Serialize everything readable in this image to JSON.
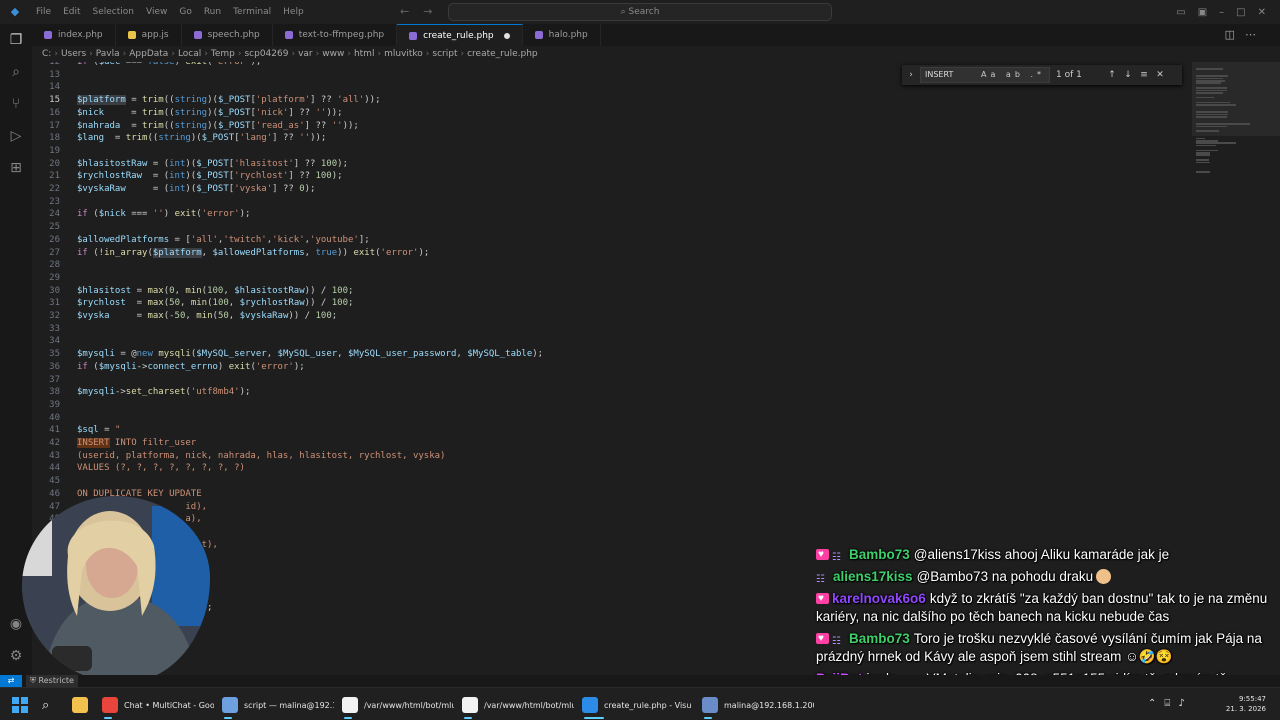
{
  "menu": [
    "File",
    "Edit",
    "Selection",
    "View",
    "Go",
    "Run",
    "Terminal",
    "Help"
  ],
  "search_placeholder": "Search",
  "tabs": [
    {
      "label": "index.php",
      "color": "#8c6bd6"
    },
    {
      "label": "app.js",
      "color": "#e8c44a"
    },
    {
      "label": "speech.php",
      "color": "#8c6bd6"
    },
    {
      "label": "text-to-ffmpeg.php",
      "color": "#8c6bd6"
    },
    {
      "label": "create_rule.php",
      "color": "#8c6bd6",
      "active": true,
      "modified": true
    },
    {
      "label": "halo.php",
      "color": "#8c6bd6"
    }
  ],
  "breadcrumb": [
    "C:",
    "Users",
    "Pavla",
    "AppData",
    "Local",
    "Temp",
    "scp04269",
    "var",
    "www",
    "html",
    "mluvitko",
    "script",
    "create_rule.php"
  ],
  "find": {
    "query": "INSERT",
    "result": "1 of 1",
    "options": "Aa ab .*"
  },
  "code": [
    {
      "n": "12",
      "html": "<span class=\"tok-ctl\">if</span> (<span class=\"tok-var\">$dec</span> === <span class=\"tok-kw\">false</span>) <span class=\"tok-fn\">exit</span>(<span class=\"tok-str\">'error'</span>);"
    },
    {
      "n": "13",
      "html": ""
    },
    {
      "n": "14",
      "html": ""
    },
    {
      "n": "15",
      "cur": true,
      "html": "<span class=\"tok-var sel\">$platform</span> = <span class=\"tok-fn\">trim</span>((<span class=\"tok-kw\">string</span>)(<span class=\"tok-var\">$_POST</span>[<span class=\"tok-str\">'platform'</span>] ?? <span class=\"tok-str\">'all'</span>));"
    },
    {
      "n": "16",
      "html": "<span class=\"tok-var\">$nick</span>     = <span class=\"tok-fn\">trim</span>((<span class=\"tok-kw\">string</span>)(<span class=\"tok-var\">$_POST</span>[<span class=\"tok-str\">'nick'</span>] ?? <span class=\"tok-str\">''</span>));"
    },
    {
      "n": "17",
      "html": "<span class=\"tok-var\">$nahrada</span>  = <span class=\"tok-fn\">trim</span>((<span class=\"tok-kw\">string</span>)(<span class=\"tok-var\">$_POST</span>[<span class=\"tok-str\">'read_as'</span>] ?? <span class=\"tok-str\">''</span>));"
    },
    {
      "n": "18",
      "html": "<span class=\"tok-var\">$lang</span>  = <span class=\"tok-fn\">trim</span>((<span class=\"tok-kw\">string</span>)(<span class=\"tok-var\">$_POST</span>[<span class=\"tok-str\">'lang'</span>] ?? <span class=\"tok-str\">''</span>));"
    },
    {
      "n": "19",
      "html": ""
    },
    {
      "n": "20",
      "html": "<span class=\"tok-var\">$hlasitostRaw</span> = (<span class=\"tok-kw\">int</span>)(<span class=\"tok-var\">$_POST</span>[<span class=\"tok-str\">'hlasitost'</span>] ?? <span class=\"tok-num\">100</span>);"
    },
    {
      "n": "21",
      "html": "<span class=\"tok-var\">$rychlostRaw</span>  = (<span class=\"tok-kw\">int</span>)(<span class=\"tok-var\">$_POST</span>[<span class=\"tok-str\">'rychlost'</span>] ?? <span class=\"tok-num\">100</span>);"
    },
    {
      "n": "22",
      "html": "<span class=\"tok-var\">$vyskaRaw</span>     = (<span class=\"tok-kw\">int</span>)(<span class=\"tok-var\">$_POST</span>[<span class=\"tok-str\">'vyska'</span>] ?? <span class=\"tok-num\">0</span>);"
    },
    {
      "n": "23",
      "html": ""
    },
    {
      "n": "24",
      "html": "<span class=\"tok-ctl\">if</span> (<span class=\"tok-var\">$nick</span> === <span class=\"tok-str\">''</span>) <span class=\"tok-fn\">exit</span>(<span class=\"tok-str\">'error'</span>);"
    },
    {
      "n": "25",
      "html": ""
    },
    {
      "n": "26",
      "html": "<span class=\"tok-var\">$allowedPlatforms</span> = [<span class=\"tok-str\">'all'</span>,<span class=\"tok-str\">'twitch'</span>,<span class=\"tok-str\">'kick'</span>,<span class=\"tok-str\">'youtube'</span>];"
    },
    {
      "n": "27",
      "html": "<span class=\"tok-ctl\">if</span> (!<span class=\"tok-fn\">in_array</span>(<span class=\"tok-var sel\">$platform</span>, <span class=\"tok-var\">$allowedPlatforms</span>, <span class=\"tok-kw\">true</span>)) <span class=\"tok-fn\">exit</span>(<span class=\"tok-str\">'error'</span>);"
    },
    {
      "n": "28",
      "html": ""
    },
    {
      "n": "29",
      "html": ""
    },
    {
      "n": "30",
      "html": "<span class=\"tok-var\">$hlasitost</span> = <span class=\"tok-fn\">max</span>(<span class=\"tok-num\">0</span>, <span class=\"tok-fn\">min</span>(<span class=\"tok-num\">100</span>, <span class=\"tok-var\">$hlasitostRaw</span>)) / <span class=\"tok-num\">100</span>;"
    },
    {
      "n": "31",
      "html": "<span class=\"tok-var\">$rychlost</span>  = <span class=\"tok-fn\">max</span>(<span class=\"tok-num\">50</span>, <span class=\"tok-fn\">min</span>(<span class=\"tok-num\">100</span>, <span class=\"tok-var\">$rychlostRaw</span>)) / <span class=\"tok-num\">100</span>;"
    },
    {
      "n": "32",
      "html": "<span class=\"tok-var\">$vyska</span>     = <span class=\"tok-fn\">max</span>(<span class=\"tok-num\">-50</span>, <span class=\"tok-fn\">min</span>(<span class=\"tok-num\">50</span>, <span class=\"tok-var\">$vyskaRaw</span>)) / <span class=\"tok-num\">100</span>;"
    },
    {
      "n": "33",
      "html": ""
    },
    {
      "n": "34",
      "html": ""
    },
    {
      "n": "35",
      "html": "<span class=\"tok-var\">$mysqli</span> = @<span class=\"tok-kw\">new</span> <span class=\"tok-fn\">mysqli</span>(<span class=\"tok-var\">$MySQL_server</span>, <span class=\"tok-var\">$MySQL_user</span>, <span class=\"tok-var\">$MySQL_user_password</span>, <span class=\"tok-var\">$MySQL_table</span>);"
    },
    {
      "n": "36",
      "html": "<span class=\"tok-ctl\">if</span> (<span class=\"tok-var\">$mysqli</span>-><span class=\"tok-var\">connect_errno</span>) <span class=\"tok-fn\">exit</span>(<span class=\"tok-str\">'error'</span>);"
    },
    {
      "n": "37",
      "html": ""
    },
    {
      "n": "38",
      "html": "<span class=\"tok-var\">$mysqli</span>-><span class=\"tok-fn\">set_charset</span>(<span class=\"tok-str\">'utf8mb4'</span>);"
    },
    {
      "n": "39",
      "html": ""
    },
    {
      "n": "40",
      "html": ""
    },
    {
      "n": "41",
      "html": "<span class=\"tok-var\">$sql</span> = <span class=\"tok-str\">\"</span>"
    },
    {
      "n": "42",
      "html": "<span class=\"tok-sql hl\">INSERT</span><span class=\"tok-sql\"> INTO filtr_user</span>"
    },
    {
      "n": "43",
      "html": "<span class=\"tok-sql\">(userid, platforma, nick, nahrada, hlas, hlasitost, rychlost, vyska)</span>"
    },
    {
      "n": "44",
      "html": "<span class=\"tok-sql\">VALUES (?, ?, ?, ?, ?, ?, ?, ?)</span>"
    },
    {
      "n": "45",
      "html": ""
    },
    {
      "n": "46",
      "html": "<span class=\"tok-sql\">ON DUPLICATE KEY UPDATE</span>"
    },
    {
      "n": "47",
      "html": "<span class=\"tok-sql\">                    id),</span>"
    },
    {
      "n": "48",
      "html": "<span class=\"tok-sql\">                    a),</span>"
    },
    {
      "n": "49",
      "html": ""
    },
    {
      "n": "50",
      "html": "<span class=\"tok-sql\">                     ost),</span>"
    },
    {
      "n": "51",
      "html": "<span class=\"tok-sql\">                     ),</span>"
    },
    {
      "n": "52",
      "html": ""
    },
    {
      "n": "53",
      "html": ""
    },
    {
      "n": "54",
      "html": ""
    },
    {
      "n": "55",
      "html": "<span class=\"tok-var\">                    sql</span>);"
    }
  ],
  "status": {
    "restricted": "Restricte"
  },
  "chat": [
    {
      "badges": [
        "heart",
        "bars"
      ],
      "user": "Bambo73",
      "color": "#3ecf6b",
      "text": "@aliens17kiss ahooj Aliku kamaráde jak je"
    },
    {
      "badges": [
        "bars"
      ],
      "user": "aliens17kiss",
      "color": "#3ecf6b",
      "text": "@Bambo73 na pohodu draku",
      "emoji": "#f0c08a"
    },
    {
      "badges": [
        "heart"
      ],
      "user": "karelnovak6o6",
      "color": "#9147ff",
      "text": "když to zkrátíš \"za každý ban dostnu\" tak to je na změnu kariéry, na nic dalšího po těch banech na kicku nebude čas"
    },
    {
      "badges": [
        "heart",
        "bars"
      ],
      "user": "Bambo73",
      "color": "#3ecf6b",
      "text": "Toro je trošku nezvyklé časové vysílání čumím jak Pája na prázdný hrnek od Kávy ale aspoň jsem stihl stream ☺🤣😵"
    },
    {
      "badges": [],
      "user": "PajiBot",
      "color": "#c94bff",
      "text": "jurda___, VMetalic, mio_008, a551n155 vidím tě, zdravím tě"
    }
  ],
  "taskbar": [
    {
      "label": "Chat • MultiChat - Goog",
      "color": "#e8453c"
    },
    {
      "label": "script — malina@192.168",
      "color": "#6ea0e0"
    },
    {
      "label": "/var/www/html/bot/mlu",
      "color": "#f2f2f2"
    },
    {
      "label": "/var/www/html/bot/mlu",
      "color": "#f2f2f2"
    },
    {
      "label": "create_rule.php - Visu",
      "color": "#2d8be8"
    },
    {
      "label": "malina@192.168.1.200",
      "color": "#6a8cc8"
    }
  ],
  "clock": {
    "time": "9:55:47",
    "date": "21. 3. 2026"
  }
}
